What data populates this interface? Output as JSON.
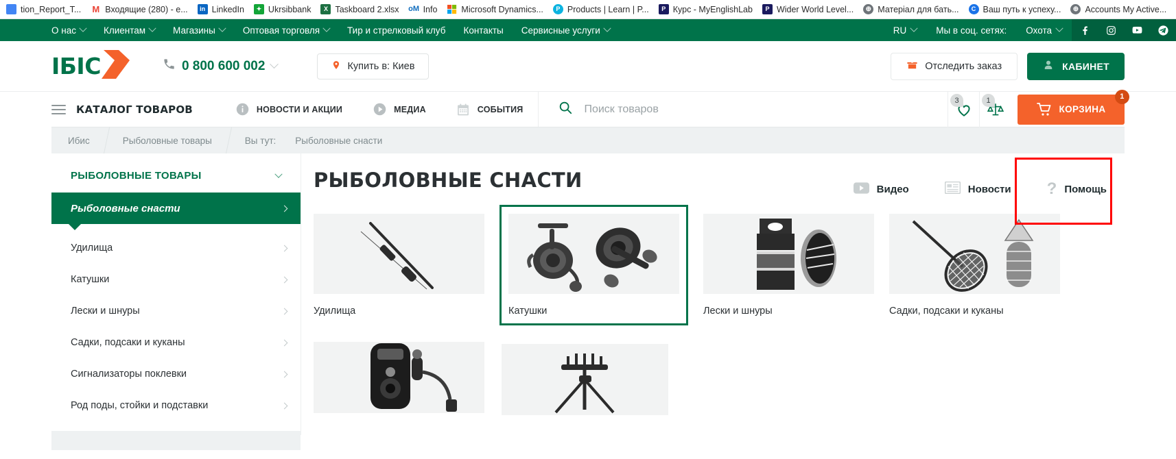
{
  "browser": {
    "bookmarks": [
      {
        "label": "tion_Report_T...",
        "icon": "doc-icon",
        "color": "#4285f4",
        "glyph": "",
        "text": ""
      },
      {
        "label": "Входящие (280) - e...",
        "icon": "gmail-icon",
        "color": "#ffffff",
        "glyph": "M",
        "text": "M"
      },
      {
        "label": "LinkedIn",
        "icon": "linkedin-icon",
        "color": "#0a66c2",
        "glyph": "in",
        "text": "in"
      },
      {
        "label": "Ukrsibbank",
        "icon": "ukrsibbank-icon",
        "color": "#13a538",
        "glyph": "✦",
        "text": "✦"
      },
      {
        "label": "Taskboard 2.xlsx",
        "icon": "excel-icon",
        "color": "#1d6f42",
        "glyph": "X",
        "text": "X"
      },
      {
        "label": "Info",
        "icon": "outlook-icon",
        "color": "#0f6cbd",
        "glyph": "o",
        "text": "oM"
      },
      {
        "label": "Microsoft Dynamics...",
        "icon": "microsoft-icon",
        "color": "#f25022",
        "glyph": "",
        "text": ""
      },
      {
        "label": "Products | Learn | P...",
        "icon": "pearson-icon",
        "color": "#0cb3e0",
        "glyph": "P",
        "text": "P"
      },
      {
        "label": "Курс - MyEnglishLab",
        "icon": "pearson-dark-icon",
        "color": "#1a1a5e",
        "glyph": "P",
        "text": "P"
      },
      {
        "label": "Wider World Level...",
        "icon": "pearson-dark-icon",
        "color": "#1a1a5e",
        "glyph": "P",
        "text": "P"
      },
      {
        "label": "Матеріал для бать...",
        "icon": "globe-icon",
        "color": "#6e7479",
        "glyph": "🌐",
        "text": ""
      },
      {
        "label": "Ваш путь к успеху...",
        "icon": "chrome-icon",
        "color": "#1a73e8",
        "glyph": "C",
        "text": "C"
      },
      {
        "label": "Accounts My Active...",
        "icon": "globe-icon",
        "color": "#6e7479",
        "glyph": "🌐",
        "text": ""
      }
    ]
  },
  "topnav": {
    "left_items": [
      {
        "label": "О нас",
        "has_caret": true
      },
      {
        "label": "Клиентам",
        "has_caret": true
      },
      {
        "label": "Магазины",
        "has_caret": true
      },
      {
        "label": "Оптовая торговля",
        "has_caret": true
      },
      {
        "label": "Тир и стрелковый клуб",
        "has_caret": false
      },
      {
        "label": "Контакты",
        "has_caret": false
      },
      {
        "label": "Сервисные услуги",
        "has_caret": true
      }
    ],
    "language": "RU",
    "social_label": "Мы в соц. сетях:",
    "social_category": "Охота",
    "socials": [
      "facebook-icon",
      "instagram-icon",
      "youtube-icon",
      "telegram-icon"
    ],
    "bg_color": "#00734a"
  },
  "header": {
    "logo_text": "ІБІС",
    "phone": "0 800 600 002",
    "city_button": "Купить в: Киев",
    "track_order": "Отследить заказ",
    "cabinet": "КАБИНЕТ"
  },
  "navrow": {
    "catalog_label": "КАТАЛОГ ТОВАРОВ",
    "links": [
      {
        "label": "НОВОСТИ И АКЦИИ",
        "icon": "info-icon"
      },
      {
        "label": "МЕДИА",
        "icon": "play-icon"
      },
      {
        "label": "СОБЫТИЯ",
        "icon": "calendar-icon"
      }
    ],
    "search_placeholder": "Поиск товаров",
    "search_value": "",
    "wishlist_count": "3",
    "compare_count": "1",
    "cart_label": "КОРЗИНА",
    "cart_count": "1",
    "cart_color": "#f4622b"
  },
  "breadcrumbs": {
    "items": [
      "Ибис",
      "Рыболовные товары"
    ],
    "you_are_here_label": "Вы тут:",
    "current": "Рыболовные снасти"
  },
  "sidebar": {
    "title": "РЫБОЛОВНЫЕ ТОВАРЫ",
    "items": [
      {
        "label": "Рыболовные снасти",
        "active": true
      },
      {
        "label": "Удилища",
        "active": false
      },
      {
        "label": "Катушки",
        "active": false
      },
      {
        "label": "Лески и шнуры",
        "active": false
      },
      {
        "label": "Садки, подсаки и куканы",
        "active": false
      },
      {
        "label": "Сигнализаторы поклевки",
        "active": false
      },
      {
        "label": "Род поды, стойки и подставки",
        "active": false
      }
    ]
  },
  "content": {
    "title": "РЫБОЛОВНЫЕ СНАСТИ",
    "actions": [
      {
        "label": "Видео",
        "icon": "video-icon"
      },
      {
        "label": "Новости",
        "icon": "news-icon"
      },
      {
        "label": "Помощь",
        "icon": "help-icon",
        "highlighted": true
      }
    ],
    "highlight_color": "#ff0000",
    "cards": [
      {
        "label": "Удилища",
        "icon": "fishing-rod-icon",
        "selected": false
      },
      {
        "label": "Катушки",
        "icon": "fishing-reel-icon",
        "selected": true
      },
      {
        "label": "Лески и шнуры",
        "icon": "fishing-line-icon",
        "selected": false
      },
      {
        "label": "Садки, подсаки и куканы",
        "icon": "landing-net-icon",
        "selected": false
      },
      {
        "label": "",
        "icon": "bite-alarm-icon",
        "selected": false
      },
      {
        "label": "",
        "icon": "rod-pod-icon",
        "selected": false
      }
    ]
  }
}
